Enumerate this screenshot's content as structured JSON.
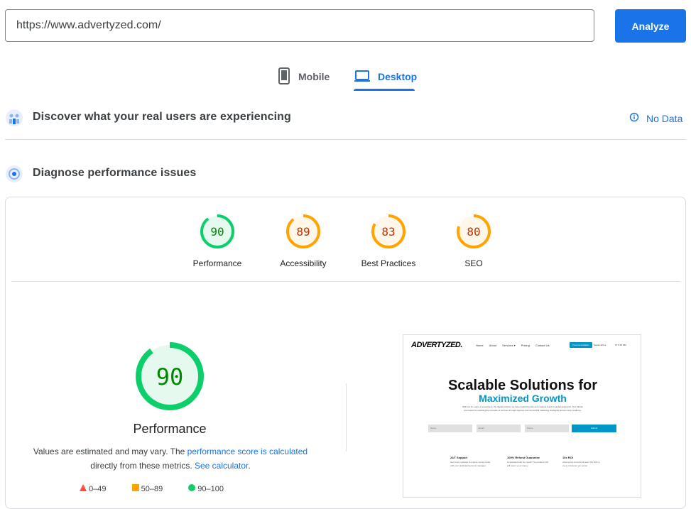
{
  "url_input": {
    "value": "https://www.advertyzed.com/"
  },
  "analyze_label": "Analyze",
  "tabs": [
    {
      "label": "Mobile",
      "icon": "phone-icon",
      "active": false
    },
    {
      "label": "Desktop",
      "icon": "laptop-icon",
      "active": true
    }
  ],
  "field_data": {
    "title": "Discover what your real users are experiencing",
    "status": "No Data"
  },
  "lab": {
    "title": "Diagnose performance issues"
  },
  "scores": [
    {
      "label": "Performance",
      "score": 90,
      "color": "#0cce6b",
      "text_color": "#008800"
    },
    {
      "label": "Accessibility",
      "score": 89,
      "color": "#ffa400",
      "text_color": "#c33300"
    },
    {
      "label": "Best Practices",
      "score": 83,
      "color": "#ffa400",
      "text_color": "#c33300"
    },
    {
      "label": "SEO",
      "score": 80,
      "color": "#ffa400",
      "text_color": "#c33300"
    }
  ],
  "main_gauge": {
    "label": "Performance",
    "score": 90
  },
  "note": {
    "prefix": "Values are estimated and may vary. The ",
    "link1": "performance score is calculated",
    "middle": "directly from these metrics. ",
    "link2": "See calculator",
    "suffix": "."
  },
  "legend": [
    "0–49",
    "50–89",
    "90–100"
  ],
  "screenshot": {
    "logo": "ADVERTYZED.",
    "nav": [
      "Home",
      "About",
      "Services ▾",
      "Pricing",
      "Contact Us"
    ],
    "cta": "Free Consultation",
    "phone": "Speak with a",
    "phone2": "07 5 45 253",
    "headline1": "Scalable Solutions for",
    "headline2": "Maximized Growth",
    "body": "With our 8+ years of expertise in the digital industry, we have helped brands and creators reach to global audiences. Our Clients are known for reaching the pinnacle of success through rigorous and successful marketing strategies across many mediums.",
    "fields": [
      "Name",
      "Email",
      "Phone"
    ],
    "submit": "Submit",
    "features": [
      {
        "title": "24/7 Support",
        "text": "Get timely updates & explore social media with your dedicated account manager."
      },
      {
        "title": "100% Refund Guarantee",
        "text": "Unsatisfied with the result? No problem! We will return your money."
      },
      {
        "title": "10x ROI",
        "text": "Advertyzed commits at least 10x ROI to every customer you serve!"
      }
    ]
  }
}
